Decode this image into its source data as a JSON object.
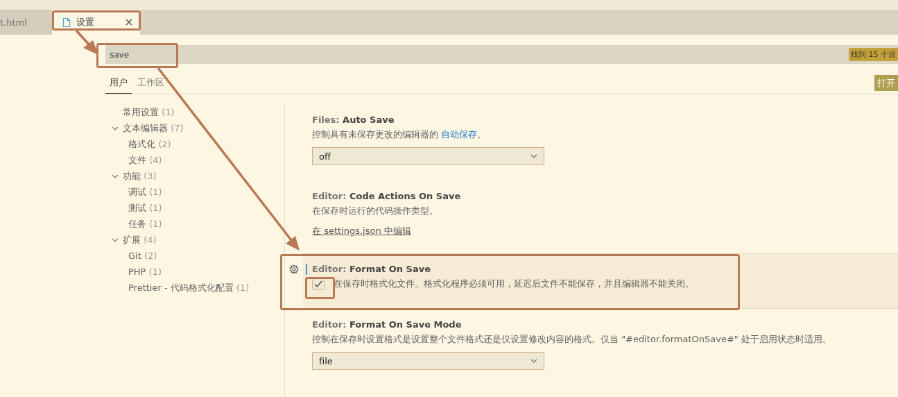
{
  "tabs": [
    {
      "label": "t.html",
      "selected": false
    },
    {
      "label": "设置",
      "selected": true
    }
  ],
  "search": {
    "value": "save",
    "result_badge": "找到 15 个设"
  },
  "scope_tabs": [
    {
      "label": "用户",
      "selected": true
    },
    {
      "label": "工作区",
      "selected": false
    }
  ],
  "open_button": "打开",
  "toc": [
    {
      "label": "常用设置",
      "count": "(1)"
    },
    {
      "label": "文本编辑器",
      "count": "(7)",
      "expanded": true,
      "children": [
        {
          "label": "格式化",
          "count": "(2)"
        },
        {
          "label": "文件",
          "count": "(4)"
        }
      ]
    },
    {
      "label": "功能",
      "count": "(3)",
      "expanded": true,
      "children": [
        {
          "label": "调试",
          "count": "(1)"
        },
        {
          "label": "测试",
          "count": "(1)"
        },
        {
          "label": "任务",
          "count": "(1)"
        }
      ]
    },
    {
      "label": "扩展",
      "count": "(4)",
      "expanded": true,
      "children": [
        {
          "label": "Git",
          "count": "(2)"
        },
        {
          "label": "PHP",
          "count": "(1)"
        },
        {
          "label": "Prettier - 代码格式化配置",
          "count": "(1)"
        }
      ]
    }
  ],
  "settings": [
    {
      "kind": "dropdown",
      "focused": false,
      "category": "Files: ",
      "name": "Auto Save",
      "description": "控制具有未保存更改的编辑器的 ",
      "link": "自动保存",
      "description_end": "。",
      "value": "off"
    },
    {
      "kind": "json",
      "focused": false,
      "category": "Editor: ",
      "name": "Code Actions On Save",
      "description": "在保存时运行的代码操作类型。",
      "edit_link": "在 settings.json 中编辑"
    },
    {
      "kind": "checkbox",
      "focused": true,
      "category": "Editor: ",
      "name": "Format On Save",
      "checked": true,
      "description": "在保存时格式化文件。格式化程序必须可用，延迟后文件不能保存，并且编辑器不能关闭。"
    },
    {
      "kind": "dropdown",
      "focused": false,
      "category": "Editor: ",
      "name": "Format On Save Mode",
      "description": "控制在保存时设置格式是设置整个文件格式还是仅设置修改内容的格式。仅当 \"#editor.formatOnSave#\" 处于启用状态时适用。",
      "value": "file"
    }
  ]
}
